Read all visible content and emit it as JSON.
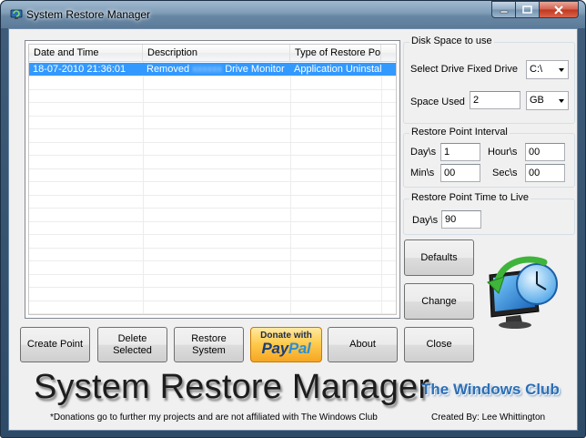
{
  "window": {
    "title": "System Restore Manager"
  },
  "list": {
    "columns": [
      "Date and Time",
      "Description",
      "Type of Restore Point"
    ],
    "rows": [
      {
        "date": "18-07-2010 21:36:01",
        "desc_prefix": "Removed",
        "desc_hidden": "xxxxxx",
        "desc_suffix": "Drive Monitor",
        "type": "Application Uninstall"
      }
    ]
  },
  "disk_space": {
    "title": "Disk Space to use",
    "drive_label": "Select Drive Fixed Drive",
    "drive_value": "C:\\",
    "used_label": "Space Used",
    "used_value": "2",
    "unit_value": "GB"
  },
  "interval": {
    "title": "Restore Point Interval",
    "days_label": "Day\\s",
    "days_value": "1",
    "hours_label": "Hour\\s",
    "hours_value": "00",
    "mins_label": "Min\\s",
    "mins_value": "00",
    "secs_label": "Sec\\s",
    "secs_value": "00"
  },
  "ttl": {
    "title": "Restore Point Time to Live",
    "days_label": "Day\\s",
    "days_value": "90"
  },
  "buttons": {
    "defaults": "Defaults",
    "change": "Change",
    "create": "Create Point",
    "delete": "Delete\nSelected",
    "restore": "Restore\nSystem",
    "donate_top": "Donate with",
    "donate_pay": "Pay",
    "donate_pal": "Pal",
    "about": "About",
    "close": "Close"
  },
  "banner": {
    "title": "System Restore Manager",
    "club": "The Windows Club",
    "footnote": "*Donations go to further my projects and are not affiliated with The Windows Club",
    "credit": "Created By: Lee Whittington"
  },
  "colors": {
    "selection": "#3399ff",
    "paypal_gold": "#ffcc4f",
    "club_blue": "#2d6fb6"
  }
}
